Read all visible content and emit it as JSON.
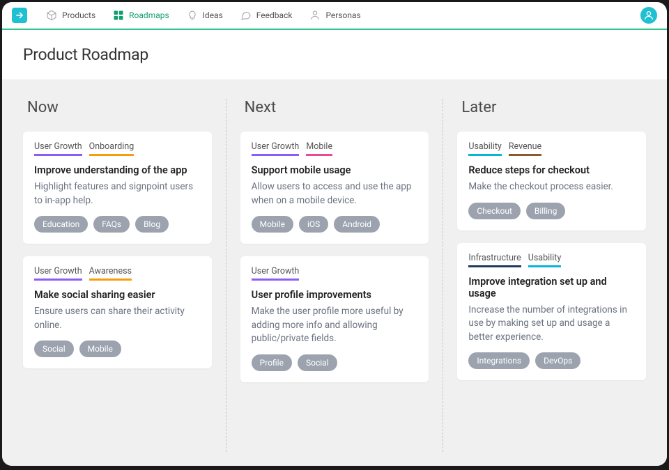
{
  "nav": {
    "items": [
      {
        "label": "Products"
      },
      {
        "label": "Roadmaps"
      },
      {
        "label": "Ideas"
      },
      {
        "label": "Feedback"
      },
      {
        "label": "Personas"
      }
    ]
  },
  "page": {
    "title": "Product Roadmap"
  },
  "columns": [
    {
      "title": "Now",
      "cards": [
        {
          "labels": [
            {
              "text": "User Growth",
              "color": "purple"
            },
            {
              "text": "Onboarding",
              "color": "orange"
            }
          ],
          "title": "Improve understanding of the app",
          "desc": "Highlight features and signpoint users to in-app help.",
          "tags": [
            "Education",
            "FAQs",
            "Blog"
          ]
        },
        {
          "labels": [
            {
              "text": "User Growth",
              "color": "purple"
            },
            {
              "text": "Awareness",
              "color": "orange"
            }
          ],
          "title": "Make social sharing easier",
          "desc": "Ensure users can share their activity online.",
          "tags": [
            "Social",
            "Mobile"
          ]
        }
      ]
    },
    {
      "title": "Next",
      "cards": [
        {
          "labels": [
            {
              "text": "User Growth",
              "color": "purple"
            },
            {
              "text": "Mobile",
              "color": "pink"
            }
          ],
          "title": "Support mobile usage",
          "desc": "Allow users to access and use the app when on a mobile device.",
          "tags": [
            "Mobile",
            "iOS",
            "Android"
          ]
        },
        {
          "labels": [
            {
              "text": "User Growth",
              "color": "purple"
            }
          ],
          "title": "User profile improvements",
          "desc": "Make the user profile more useful by adding more info and allowing public/private fields.",
          "tags": [
            "Profile",
            "Social"
          ]
        }
      ]
    },
    {
      "title": "Later",
      "cards": [
        {
          "labels": [
            {
              "text": "Usability",
              "color": "cyan"
            },
            {
              "text": "Revenue",
              "color": "brown"
            }
          ],
          "title": "Reduce steps for checkout",
          "desc": "Make the checkout process easier.",
          "tags": [
            "Checkout",
            "Billing"
          ]
        },
        {
          "labels": [
            {
              "text": "Infrastructure",
              "color": "navy"
            },
            {
              "text": "Usability",
              "color": "cyan"
            }
          ],
          "title": "Improve integration set up and usage",
          "desc": "Increase the number of integrations in use by making set up and usage a better experience.",
          "tags": [
            "Integrations",
            "DevOps"
          ]
        }
      ]
    }
  ]
}
